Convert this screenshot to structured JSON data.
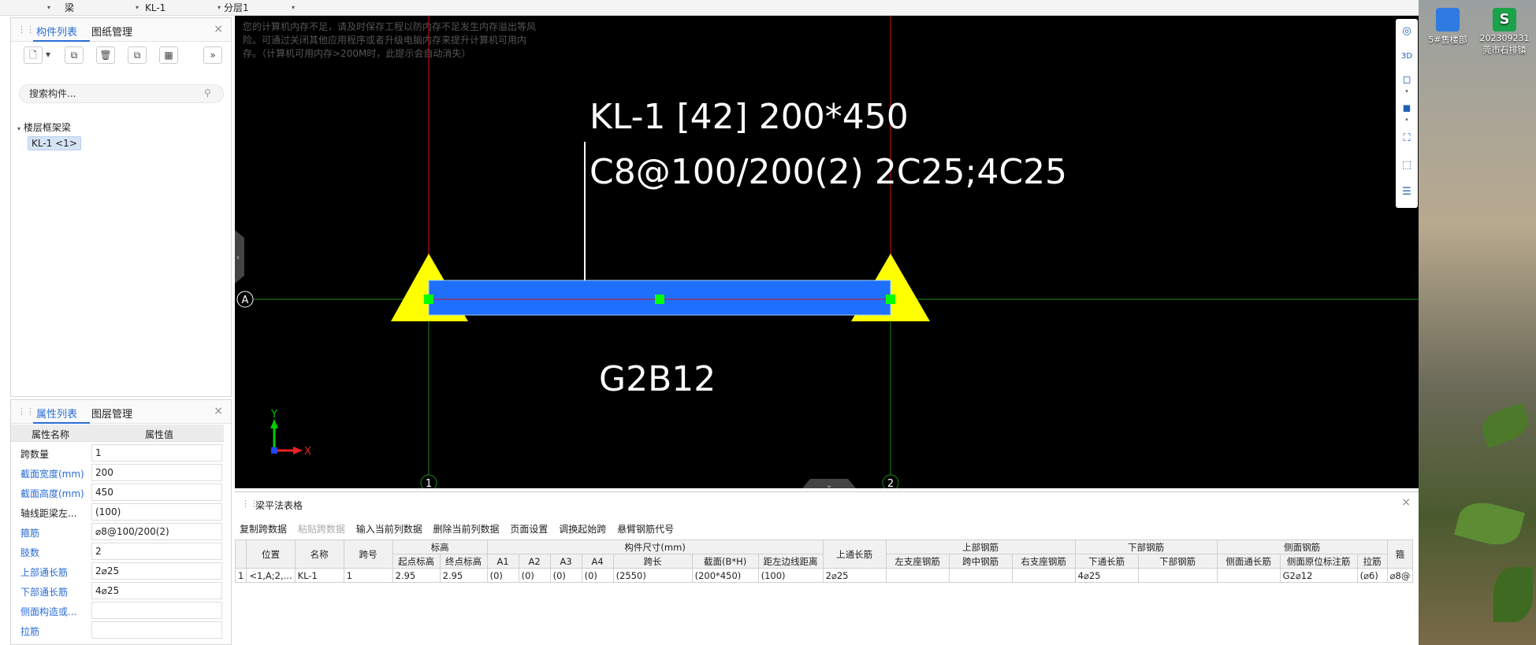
{
  "topbar": {
    "sel1": "梁",
    "sel2": "KL-1",
    "sel3": "分层1"
  },
  "component_panel": {
    "tab_active": "构件列表",
    "tab_other": "图纸管理",
    "search_placeholder": "搜索构件...",
    "tree_group": "楼层框架梁",
    "tree_item": "KL-1 <1>"
  },
  "property_panel": {
    "tab_active": "属性列表",
    "tab_other": "图层管理",
    "col_name": "属性名称",
    "col_value": "属性值",
    "rows": [
      {
        "name": "跨数量",
        "value": "1",
        "blue": false
      },
      {
        "name": "截面宽度(mm)",
        "value": "200",
        "blue": true
      },
      {
        "name": "截面高度(mm)",
        "value": "450",
        "blue": true
      },
      {
        "name": "轴线距梁左...",
        "value": "(100)",
        "blue": false
      },
      {
        "name": "箍筋",
        "value": "⌀8@100/200(2)",
        "blue": true
      },
      {
        "name": "肢数",
        "value": "2",
        "blue": true
      },
      {
        "name": "上部通长筋",
        "value": "2⌀25",
        "blue": true
      },
      {
        "name": "下部通长筋",
        "value": "4⌀25",
        "blue": true
      },
      {
        "name": "侧面构造或...",
        "value": "",
        "blue": true
      },
      {
        "name": "拉筋",
        "value": "",
        "blue": true
      }
    ]
  },
  "canvas": {
    "warning": "您的计算机内存不足，请及时保存工程以防内存不足发生内存溢出等风险。可通过关闭其他应用程序或者升级电脑内存来提升计算机可用内存。（计算机可用内存>200M时，此提示会自动消失）",
    "beam_label_line1": "KL-1 [42] 200*450",
    "beam_label_line2": "C8@100/200(2) 2C25;4C25",
    "beam_side_label": "G2B12",
    "axis_a": "A",
    "axis_1": "1",
    "axis_2": "2",
    "ucs_x": "X",
    "ucs_y": "Y",
    "colors": {
      "beam": "#1f6fff",
      "support": "#ffff00",
      "grip": "#00ff00",
      "axis_red": "#d01010",
      "axis_green": "#1a8a1a"
    }
  },
  "right_toolbar": {
    "icons": [
      "orbit-icon",
      "3d-view-icon",
      "cube-icon",
      "solid-cube-icon",
      "zoom-extents-icon",
      "box-select-icon",
      "list-view-icon"
    ]
  },
  "desktop": {
    "icon1": "5#售楼部",
    "icon2_line1": "202309231",
    "icon2_line2": "莞市石排镇"
  },
  "bottom_panel": {
    "title": "梁平法表格",
    "tools": [
      "复制跨数据",
      "粘贴跨数据",
      "输入当前列数据",
      "删除当前列数据",
      "页面设置",
      "调换起始跨",
      "悬臂钢筋代号"
    ],
    "headers_top": [
      "位置",
      "名称",
      "跨号",
      "标高",
      "构件尺寸(mm)",
      "上通长筋",
      "上部钢筋",
      "下部钢筋",
      "侧面钢筋",
      "箍"
    ],
    "headers_sub": [
      "起点标高",
      "终点标高",
      "A1",
      "A2",
      "A3",
      "A4",
      "跨长",
      "截面(B*H)",
      "距左边线距离",
      "左支座钢筋",
      "跨中钢筋",
      "右支座钢筋",
      "下通长筋",
      "下部钢筋",
      "侧面通长筋",
      "侧面原位标注筋",
      "拉筋"
    ],
    "row": {
      "idx": "1",
      "pos": "<1,A;2,...",
      "name": "KL-1",
      "span": "1",
      "start_elev": "2.95",
      "end_elev": "2.95",
      "a1": "(0)",
      "a2": "(0)",
      "a3": "(0)",
      "a4": "(0)",
      "span_len": "(2550)",
      "section": "(200*450)",
      "dist_left": "(100)",
      "top_through": "2⌀25",
      "left_support": "",
      "mid": "",
      "right_support": "",
      "bottom_through": "4⌀25",
      "bottom_bars": "",
      "side_through": "",
      "side_marked": "G2⌀12",
      "tie": "(⌀6)",
      "stirrup": "⌀8@"
    }
  }
}
